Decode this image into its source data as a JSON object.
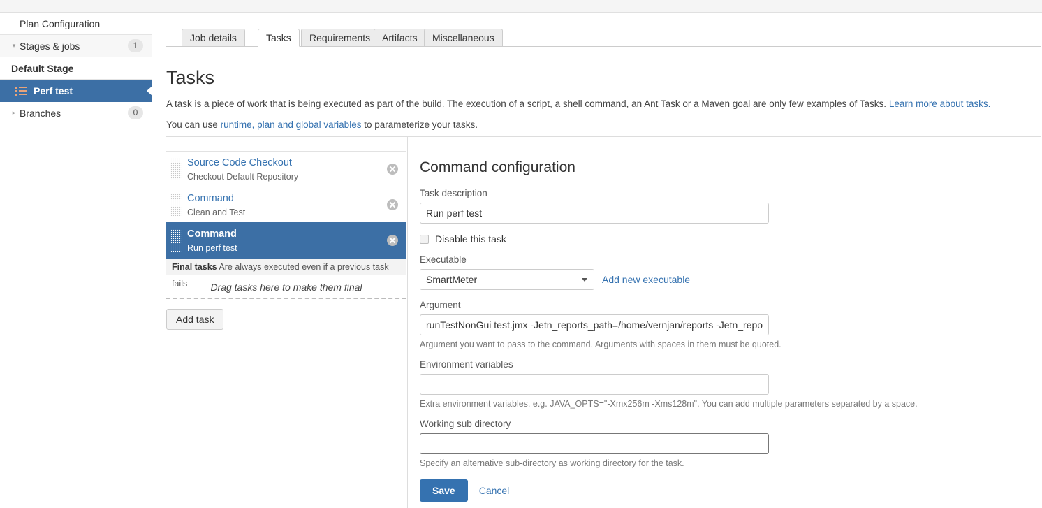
{
  "sidebar": {
    "items": [
      {
        "label": "Plan Configuration",
        "caret": "",
        "badge": "",
        "selected": false,
        "level": 0
      },
      {
        "label": "Stages & jobs",
        "caret": "▾",
        "badge": "1",
        "selected": false,
        "level": 0
      },
      {
        "label": "Default Stage",
        "caret": "",
        "badge": "",
        "selected": false,
        "level": 1
      },
      {
        "label": "Perf test",
        "caret": "",
        "badge": "",
        "selected": true,
        "level": 2,
        "icon": "list-icon"
      },
      {
        "label": "Branches",
        "caret": "▸",
        "badge": "0",
        "selected": false,
        "level": 0
      }
    ]
  },
  "tabs": [
    {
      "label": "Job details",
      "active": false
    },
    {
      "label": "Tasks",
      "active": true
    },
    {
      "label": "Requirements",
      "active": false
    },
    {
      "label": "Artifacts",
      "active": false
    },
    {
      "label": "Miscellaneous",
      "active": false
    }
  ],
  "main": {
    "title": "Tasks",
    "description_1a": "A task is a piece of work that is being executed as part of the build. The execution of a script, a shell command, an Ant Task or a Maven goal are only few examples of Tasks. ",
    "description_1_link": "Learn more about tasks.",
    "description_2a": "You can use ",
    "description_2_link": "runtime, plan and global variables",
    "description_2b": " to parameterize your tasks."
  },
  "tasklist": {
    "tasks": [
      {
        "title": "Source Code Checkout",
        "subtitle": "Checkout Default Repository",
        "selected": false
      },
      {
        "title": "Command",
        "subtitle": "Clean and Test",
        "selected": false
      },
      {
        "title": "Command",
        "subtitle": "Run perf test",
        "selected": true
      }
    ],
    "final_bar_bold": "Final tasks",
    "final_bar_text": " Are always executed even if a previous task fails",
    "dropzone_text": "Drag tasks here to make them final",
    "add_task_label": "Add task"
  },
  "config": {
    "heading": "Command configuration",
    "task_description_label": "Task description",
    "task_description_value": "Run perf test",
    "disable_task_label": "Disable this task",
    "disable_task_checked": false,
    "executable_label": "Executable",
    "executable_value": "SmartMeter",
    "executable_options": [
      "SmartMeter"
    ],
    "add_new_executable_label": "Add new executable",
    "argument_label": "Argument",
    "argument_value": "runTestNonGui test.jmx -Jetn_reports_path=/home/vernjan/reports -Jetn_repor",
    "argument_help": "Argument you want to pass to the command. Arguments with spaces in them must be quoted.",
    "env_label": "Environment variables",
    "env_value": "",
    "env_help": "Extra environment variables. e.g. JAVA_OPTS=\"-Xmx256m -Xms128m\". You can add multiple parameters separated by a space.",
    "workdir_label": "Working sub directory",
    "workdir_value": "",
    "workdir_help": "Specify an alternative sub-directory as working directory for the task.",
    "save_label": "Save",
    "cancel_label": "Cancel"
  },
  "colors": {
    "accent_blue": "#3572b0",
    "selection_blue": "#3c6fa5",
    "link_blue": "#3572b0"
  }
}
